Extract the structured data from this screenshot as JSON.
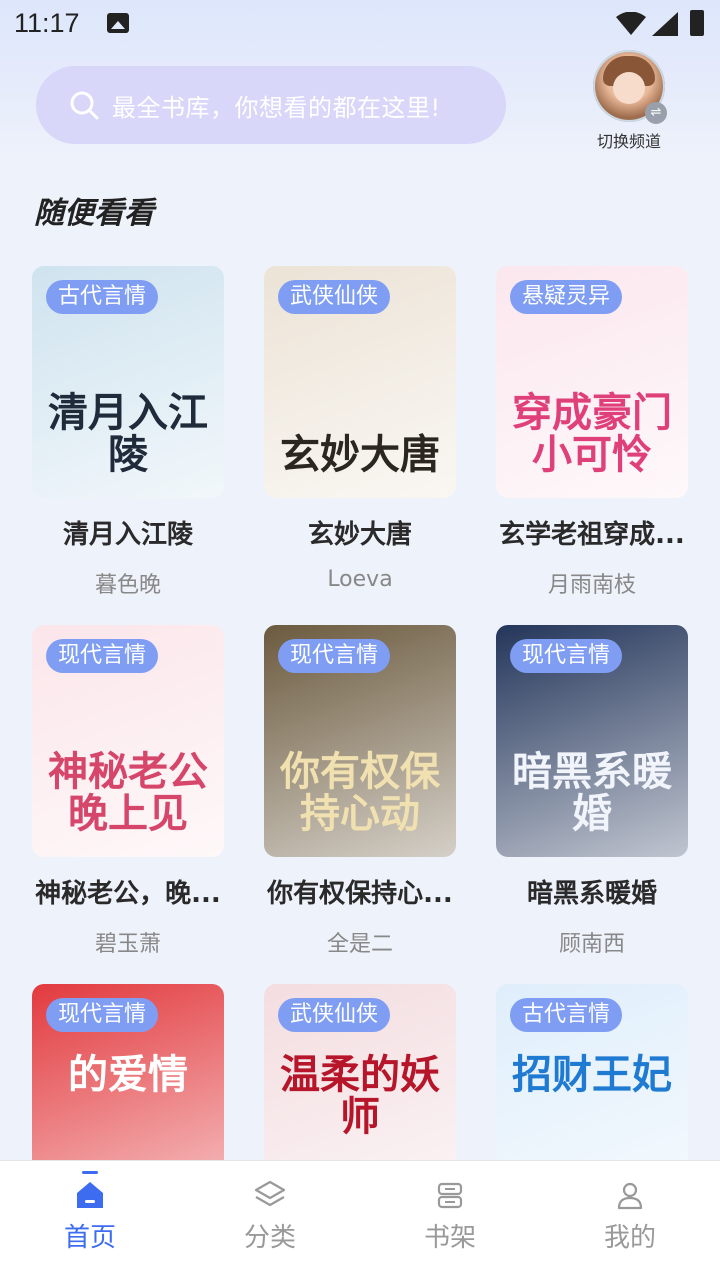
{
  "status_bar": {
    "time": "11:17"
  },
  "search": {
    "placeholder": "最全书库，你想看的都在这里!"
  },
  "channel": {
    "label": "切换频道"
  },
  "section": {
    "title": "随便看看"
  },
  "books": [
    {
      "tag": "古代言情",
      "title": "清月入江陵",
      "author": "暮色晚",
      "cover_text": "清月入江陵",
      "cover_bg": "#cfe3ef",
      "cover_fg": "#1f2a3a"
    },
    {
      "tag": "武侠仙侠",
      "title": "玄妙大唐",
      "author": "Loeva",
      "cover_text": "玄妙大唐",
      "cover_bg": "#ece3d6",
      "cover_fg": "#2b2620"
    },
    {
      "tag": "悬疑灵异",
      "title": "玄学老祖穿成...",
      "author": "月雨南枝",
      "cover_text": "穿成豪门小可怜",
      "cover_bg": "#fbe7ee",
      "cover_fg": "#e0407a"
    },
    {
      "tag": "现代言情",
      "title": "神秘老公，晚...",
      "author": "碧玉萧",
      "cover_text": "神秘老公晚上见",
      "cover_bg": "#fbe6ea",
      "cover_fg": "#d6456a"
    },
    {
      "tag": "现代言情",
      "title": "你有权保持心...",
      "author": "全是二",
      "cover_text": "你有权保持心动",
      "cover_bg": "#6b5a3e",
      "cover_fg": "#f2e1b0"
    },
    {
      "tag": "现代言情",
      "title": "暗黑系暖婚",
      "author": "顾南西",
      "cover_text": "暗黑系暖婚",
      "cover_bg": "#23355a",
      "cover_fg": "#f1f4fb"
    },
    {
      "tag": "现代言情",
      "title": "",
      "author": "",
      "cover_text": "的爱情",
      "cover_bg": "#e23a3e",
      "cover_fg": "#ffffff"
    },
    {
      "tag": "武侠仙侠",
      "title": "",
      "author": "",
      "cover_text": "温柔的妖师",
      "cover_bg": "#f3dde0",
      "cover_fg": "#b7152a"
    },
    {
      "tag": "古代言情",
      "title": "",
      "author": "",
      "cover_text": "招财王妃",
      "cover_bg": "#dfeefb",
      "cover_fg": "#1f7ad1"
    }
  ],
  "tabs": [
    {
      "label": "首页",
      "icon": "home-icon"
    },
    {
      "label": "分类",
      "icon": "layers-icon"
    },
    {
      "label": "书架",
      "icon": "shelf-icon"
    },
    {
      "label": "我的",
      "icon": "user-icon"
    }
  ],
  "colors": {
    "accent": "#3d6cf0",
    "tag_bg": "#7f9ef3",
    "search_bg": "#d8d6f9"
  }
}
